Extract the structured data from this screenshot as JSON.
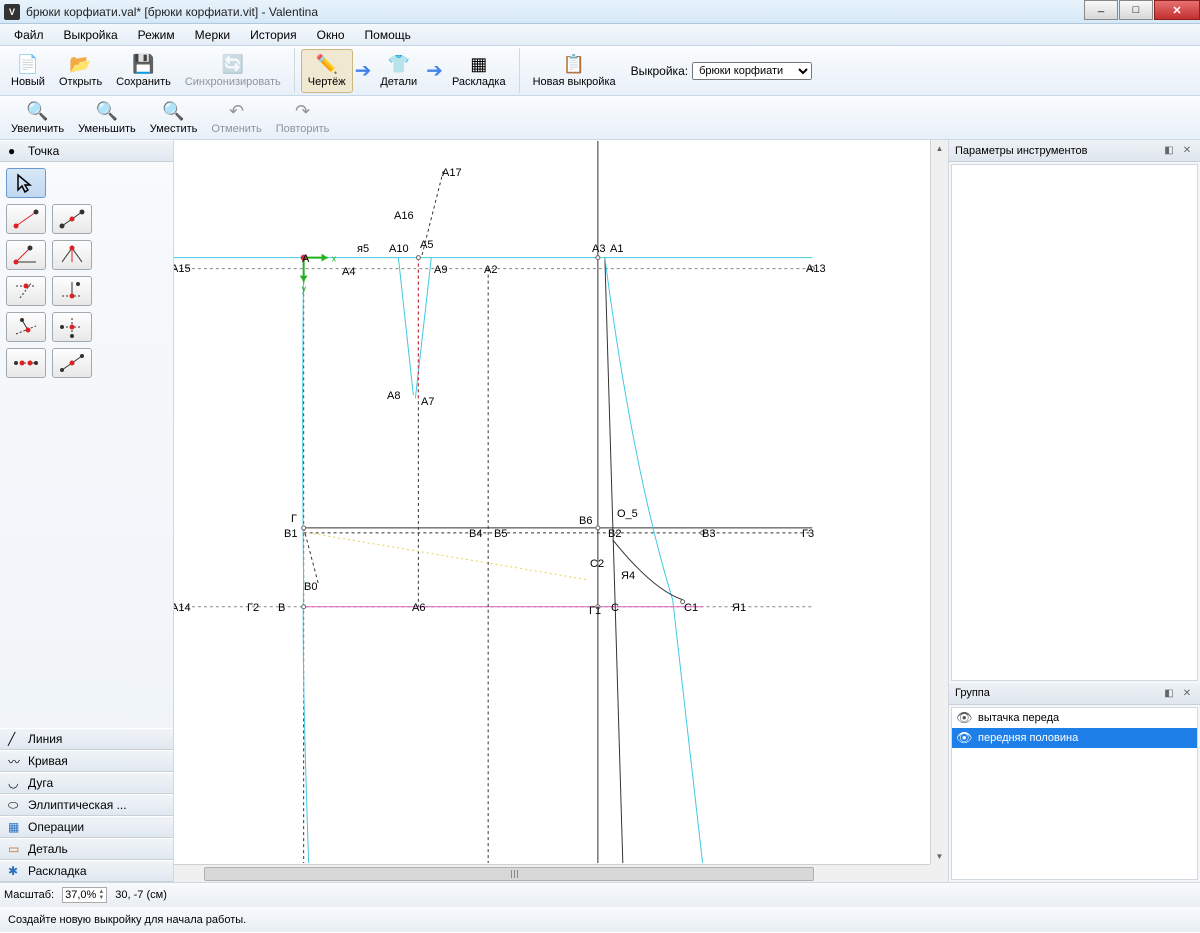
{
  "window": {
    "title": "брюки корфиати.val* [брюки корфиати.vit] - Valentina"
  },
  "menu": {
    "items": [
      "Файл",
      "Выкройка",
      "Режим",
      "Мерки",
      "История",
      "Окно",
      "Помощь"
    ]
  },
  "toolbar1": {
    "new": "Новый",
    "open": "Открыть",
    "save": "Сохранить",
    "sync": "Синхронизировать",
    "draft": "Чертёж",
    "details": "Детали",
    "layout": "Раскладка",
    "newpattern": "Новая выкройка",
    "pattern_label": "Выкройка:",
    "pattern_value": "брюки корфиати"
  },
  "toolbar2": {
    "zoomin": "Увеличить",
    "zoomout": "Уменьшить",
    "zoomfit": "Уместить",
    "undo": "Отменить",
    "redo": "Повторить"
  },
  "leftpane": {
    "categories": {
      "point": "Точка",
      "line": "Линия",
      "curve": "Кривая",
      "arc": "Дуга",
      "elliptical": "Эллиптическая ...",
      "operations": "Операции",
      "detail": "Деталь",
      "layout": "Раскладка"
    }
  },
  "right": {
    "params_title": "Параметры инструментов",
    "group_title": "Группа",
    "groups": [
      {
        "name": "вытачка переда",
        "selected": false
      },
      {
        "name": "передняя половина",
        "selected": true
      }
    ]
  },
  "status": {
    "scale_label": "Масштаб:",
    "scale_value": "37,0%",
    "coords": "30, -7 (см)",
    "hint": "Создайте новую выкройку  для начала работы."
  },
  "canvas_points": {
    "A17": "A17",
    "A16": "A16",
    "ya5": "я5",
    "A10": "A10",
    "A5": "A5",
    "A3": "A3",
    "A1": "A1",
    "A15": "A15",
    "A": "А",
    "A4": "A4",
    "A9": "A9",
    "A2": "A2",
    "A13": "A13",
    "A8": "A8",
    "A7": "A7",
    "G": "Г",
    "O5": "О_5",
    "B6": "B6",
    "B1": "B1",
    "B4": "B4",
    "B5": "B5",
    "B2": "B2",
    "B3": "B3",
    "G3": "Г3",
    "C2": "С2",
    "Ya4": "Я4",
    "B0": "B0",
    "C": "С",
    "C1": "С1",
    "Ya1": "Я1",
    "A14": "A14",
    "G2": "Г2",
    "B": "B",
    "A6": "A6",
    "G1": "Г1"
  }
}
